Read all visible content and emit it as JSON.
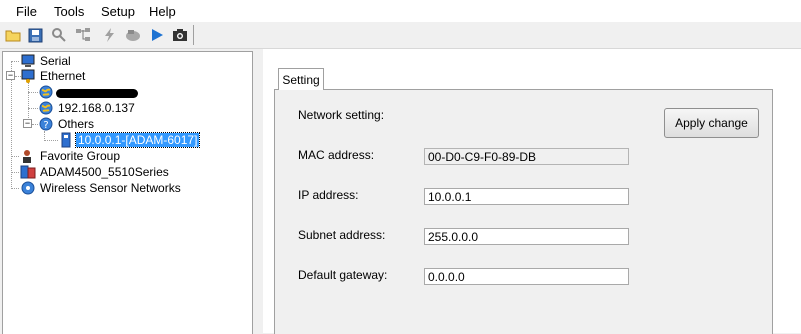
{
  "menu": [
    "File",
    "Tools",
    "Setup",
    "Help"
  ],
  "toolbar": {
    "icons": [
      "open-folder-icon",
      "save-icon",
      "search-icon",
      "network-icon",
      "lightning-icon",
      "terminal-icon",
      "play-icon",
      "camera-icon"
    ]
  },
  "tree": {
    "serial": "Serial",
    "ethernet": "Ethernet",
    "ip_137": "192.168.0.137",
    "others": "Others",
    "device_selected": "10.0.0.1-[ADAM-6017]",
    "favorite": "Favorite Group",
    "adam4500": "ADAM4500_5510Series",
    "wireless": "Wireless Sensor Networks"
  },
  "tab": {
    "label": "Setting"
  },
  "form": {
    "network_setting_label": "Network setting:",
    "apply_button": "Apply change",
    "mac_label": "MAC address:",
    "mac_value": "00-D0-C9-F0-89-DB",
    "ip_label": "IP address:",
    "ip_value": "10.0.0.1",
    "subnet_label": "Subnet address:",
    "subnet_value": "255.0.0.0",
    "gateway_label": "Default gateway:",
    "gateway_value": "0.0.0.0"
  },
  "colors": {
    "selection": "#3399ff",
    "accent": "#1e73d2"
  }
}
